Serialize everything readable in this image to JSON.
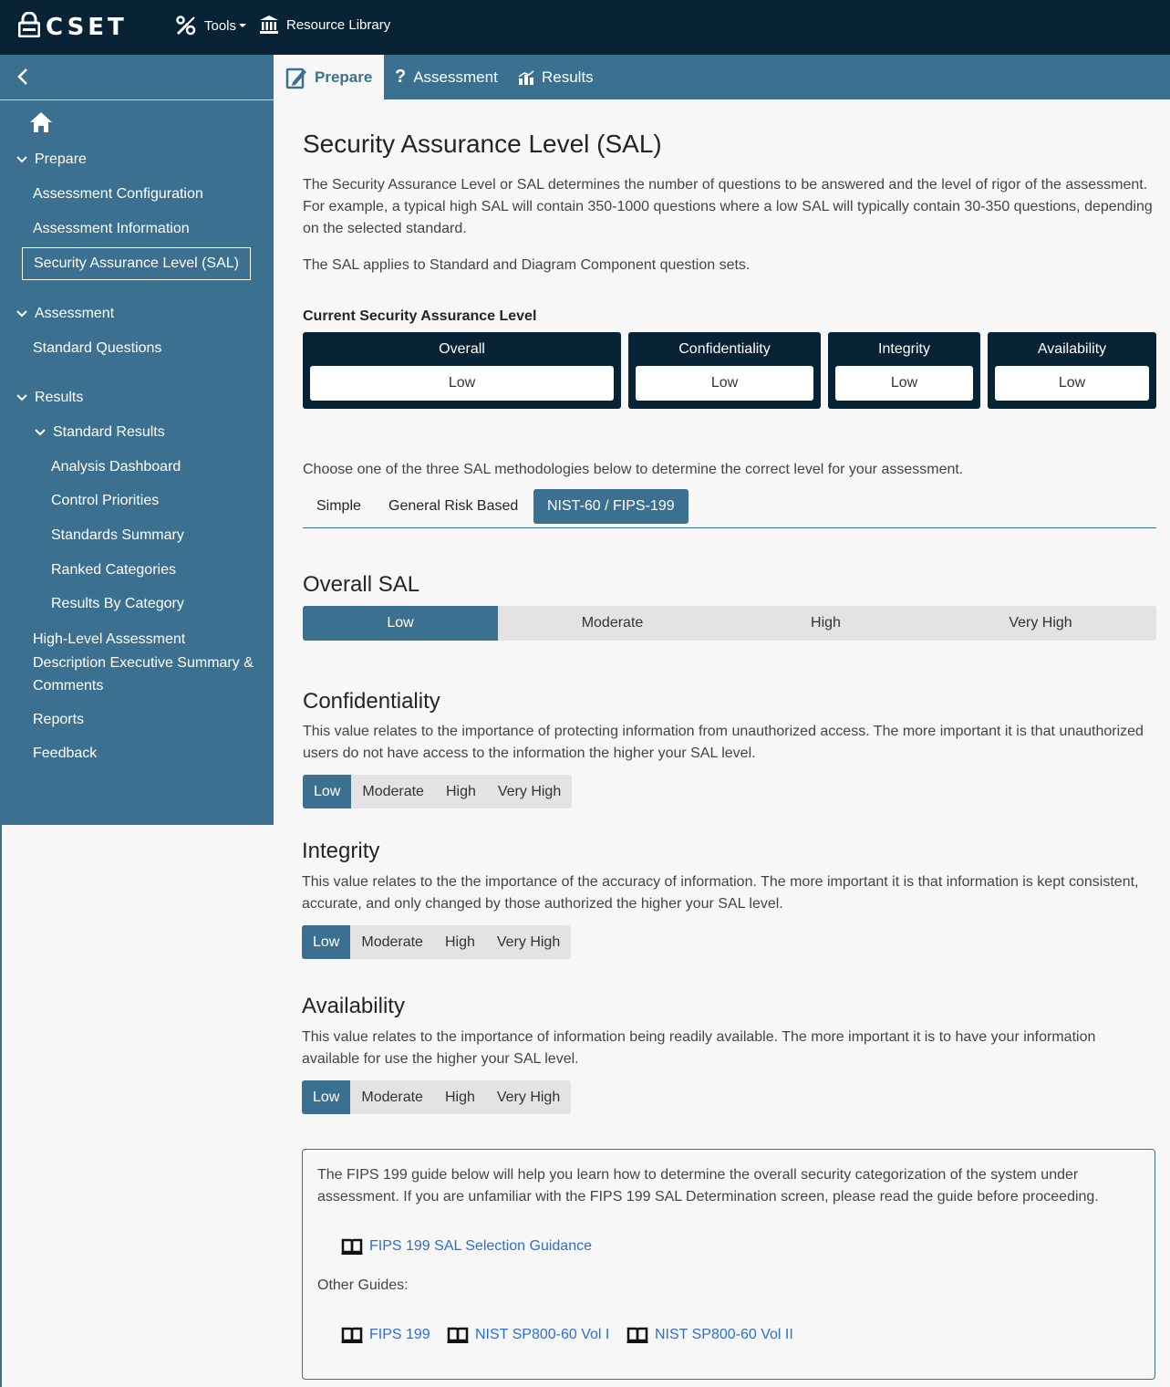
{
  "app": {
    "logo_text": "CSET",
    "tools_label": "Tools",
    "resource_library_label": "Resource Library"
  },
  "tabs": [
    {
      "label": "Prepare"
    },
    {
      "label": "Assessment"
    },
    {
      "label": "Results"
    }
  ],
  "sidebar": {
    "sections": [
      {
        "label": "Prepare",
        "items": [
          "Assessment Configuration",
          "Assessment Information",
          "Security Assurance Level (SAL)"
        ]
      },
      {
        "label": "Assessment",
        "items": [
          "Standard Questions"
        ]
      },
      {
        "label": "Results",
        "subsection": "Standard Results",
        "items": [
          "Analysis Dashboard",
          "Control Priorities",
          "Standards Summary",
          "Ranked Categories",
          "Results By Category"
        ]
      }
    ],
    "extra_items": [
      "High-Level Assessment",
      "Description Executive Summary &",
      "Comments",
      "Reports",
      "Feedback"
    ]
  },
  "page": {
    "title": "Security Assurance Level (SAL)",
    "intro_line1": "The Security Assurance Level or SAL determines the number of questions to be answered and the level of rigor of the assessment.",
    "intro_line2": "For example, a typical high SAL will contain 350-1000 questions where a low SAL will typically contain 30-350 questions, depending",
    "intro_line3": "on the selected standard.",
    "applies": "The SAL applies to Standard and Diagram Component question sets.",
    "current_label": "Current Security Assurance Level",
    "current": [
      {
        "label": "Overall",
        "value": "Low"
      },
      {
        "label": "Confidentiality",
        "value": "Low"
      },
      {
        "label": "Integrity",
        "value": "Low"
      },
      {
        "label": "Availability",
        "value": "Low"
      }
    ],
    "choose": "Choose one of the three SAL methodologies below to determine the correct level for your assessment.",
    "methods": [
      "Simple",
      "General Risk Based",
      "NIST-60 / FIPS-199"
    ],
    "active_method": "NIST-60 / FIPS-199",
    "overall_title": "Overall SAL",
    "levels": [
      "Low",
      "Moderate",
      "High",
      "Very High"
    ],
    "selected_level": "Low",
    "conf_title": "Confidentiality",
    "conf_line1": "This value relates to the importance of protecting information from unauthorized access. The more important it is that unauthorized",
    "conf_line2": "users do not have access to the information the higher your SAL level.",
    "int_title": "Integrity",
    "int_line1": "This value relates to the the importance of the accuracy of information. The more important it is that information is kept consistent,",
    "int_line2": "accurate, and only changed by those authorized the higher your SAL level.",
    "avail_title": "Availability",
    "avail_line1": "This value relates to the importance of information being readily available. The more important it is to have your information",
    "avail_line2": "available for use the higher your SAL level.",
    "guide_line1": "The FIPS 199 guide below will help you learn how to determine the overall security categorization of the system under",
    "guide_line2": "assessment. If you are unfamiliar with the FIPS 199 SAL Determination screen, please read the guide before proceeding.",
    "guide_main_link": "FIPS 199 SAL Selection Guidance",
    "other_guides_label": "Other Guides:",
    "other_guides": [
      "FIPS 199",
      "NIST SP800-60 Vol I",
      "NIST SP800-60 Vol II"
    ]
  },
  "colors": {
    "navy": "#082336",
    "steel_blue": "#3b7091",
    "link": "#2c6ed6"
  }
}
